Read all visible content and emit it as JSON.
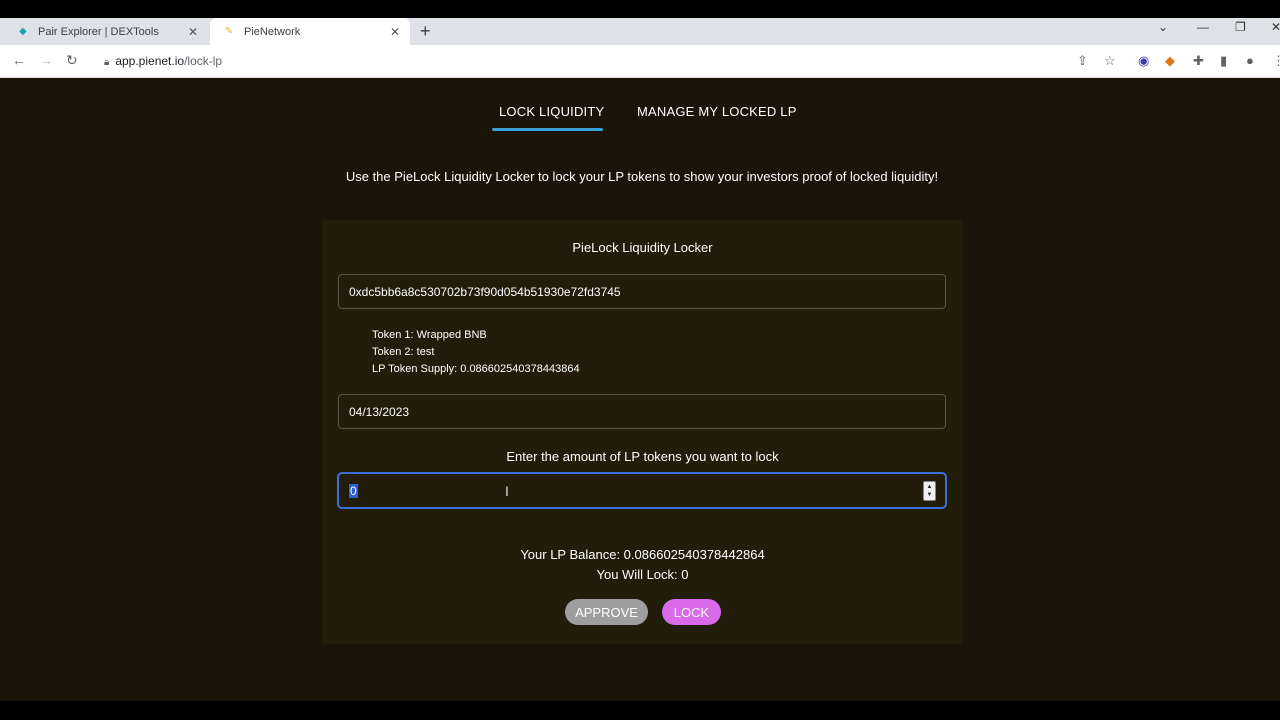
{
  "browser": {
    "tabs": [
      {
        "title": "Pair Explorer | DEXTools"
      },
      {
        "title": "PieNetwork"
      }
    ],
    "url_host": "app.pienet.io",
    "url_path": "/lock-lp"
  },
  "nav": {
    "tabs": [
      {
        "label": "LOCK LIQUIDITY"
      },
      {
        "label": "MANAGE MY LOCKED LP"
      }
    ]
  },
  "intro": "Use the PieLock Liquidity Locker to lock your LP tokens to show your investors proof of locked liquidity!",
  "locker": {
    "title": "PieLock Liquidity Locker",
    "pair_address": "0xdc5bb6a8c530702b73f90d054b51930e72fd3745",
    "token1": "Token 1: Wrapped BNB",
    "token2": "Token 2: test",
    "lp_supply": "LP Token Supply: 0.086602540378443864",
    "unlock_date": "04/13/2023",
    "amount_label": "Enter the amount of LP tokens you want to lock",
    "amount_value": "0",
    "lp_balance": "Your LP Balance: 0.086602540378442864",
    "will_lock": "You Will Lock: 0",
    "approve_label": "APPROVE",
    "lock_label": "LOCK"
  }
}
